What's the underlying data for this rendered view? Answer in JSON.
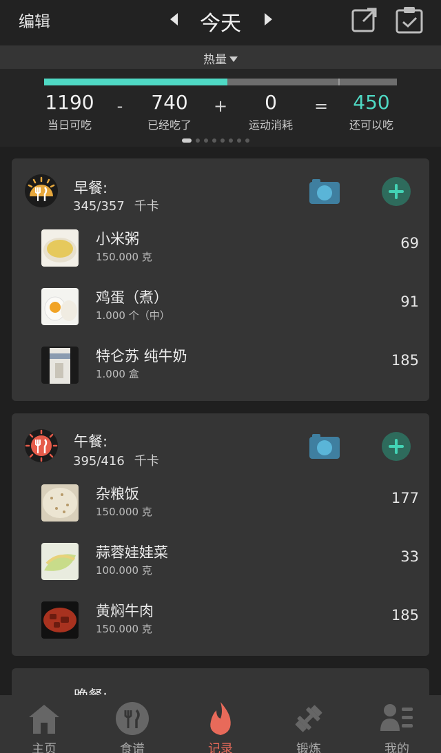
{
  "header": {
    "edit_label": "编辑",
    "date_title": "今天"
  },
  "metric_selector": {
    "label": "热量"
  },
  "summary": {
    "progress_fraction": 0.52,
    "stats": [
      {
        "value": "1190",
        "label": "当日可吃"
      },
      {
        "value": "740",
        "label": "已经吃了"
      },
      {
        "value": "0",
        "label": "运动消耗"
      },
      {
        "value": "450",
        "label": "还可以吃"
      }
    ],
    "operators": [
      "-",
      "+",
      "="
    ],
    "accent": "#4fd9c4",
    "page_dots": 8,
    "active_dot": 0
  },
  "meals": [
    {
      "name": "早餐:",
      "kcal": "345/357",
      "unit": "千卡",
      "icon": "breakfast-sun-icon",
      "foods": [
        {
          "name": "小米粥",
          "qty": "150.000 克",
          "cal": "69"
        },
        {
          "name": "鸡蛋（煮）",
          "qty": "1.000 个（中）",
          "cal": "91"
        },
        {
          "name": "特仑苏 纯牛奶",
          "qty": "1.000 盒",
          "cal": "185"
        }
      ]
    },
    {
      "name": "午餐:",
      "kcal": "395/416",
      "unit": "千卡",
      "icon": "lunch-sun-icon",
      "foods": [
        {
          "name": "杂粮饭",
          "qty": "150.000 克",
          "cal": "177"
        },
        {
          "name": "蒜蓉娃娃菜",
          "qty": "100.000 克",
          "cal": "33"
        },
        {
          "name": "黄焖牛肉",
          "qty": "150.000 克",
          "cal": "185"
        }
      ]
    }
  ],
  "dinner": {
    "name": "晚餐:"
  },
  "tabs": [
    {
      "label": "主页",
      "icon": "home-icon"
    },
    {
      "label": "食谱",
      "icon": "recipe-icon"
    },
    {
      "label": "记录",
      "icon": "flame-icon"
    },
    {
      "label": "锻炼",
      "icon": "dumbbell-icon"
    },
    {
      "label": "我的",
      "icon": "profile-icon"
    }
  ],
  "active_tab": 2
}
